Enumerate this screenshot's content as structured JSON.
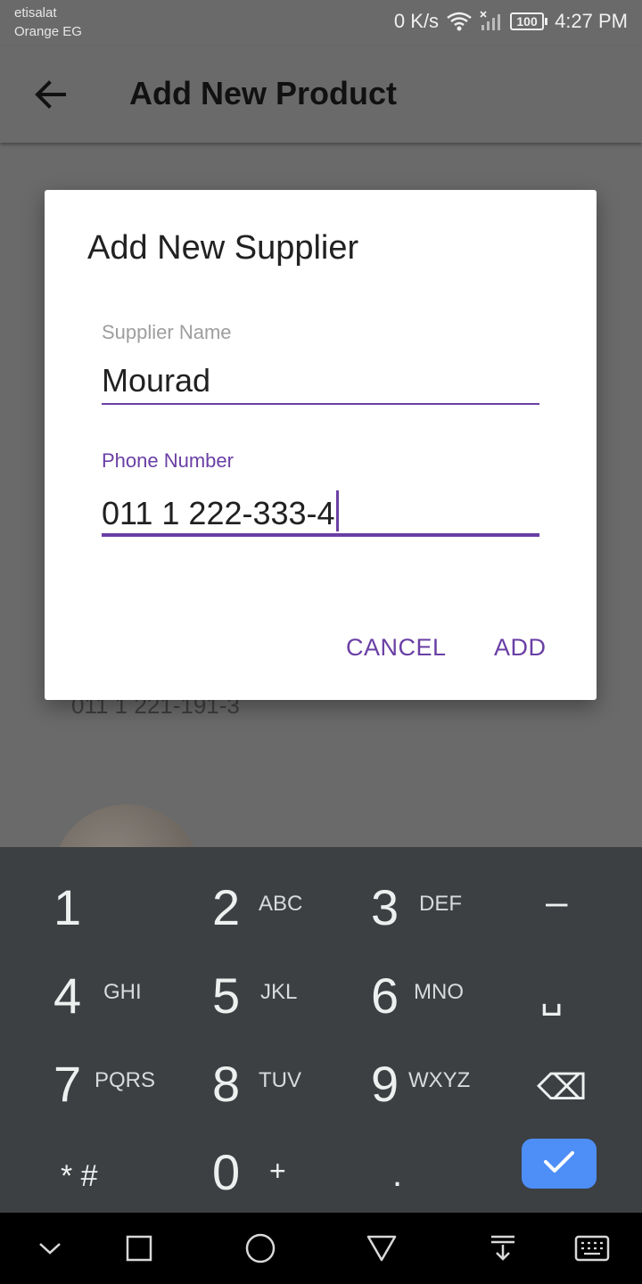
{
  "status_bar": {
    "carrier_line1": "etisalat",
    "carrier_line2": "Orange EG",
    "net_speed": "0 K/s",
    "battery": "100",
    "time": "4:27 PM"
  },
  "app_bar": {
    "title": "Add New Product",
    "back_icon": "arrow-back-icon"
  },
  "background": {
    "phone": "011 1 221-191-3"
  },
  "dialog": {
    "title": "Add New Supplier",
    "supplier_name_label": "Supplier Name",
    "supplier_name_value": "Mourad",
    "phone_label": "Phone Number",
    "phone_value": "011 1 222-333-4",
    "cancel_label": "CANCEL",
    "add_label": "ADD",
    "accent_color": "#6a3fa5"
  },
  "keyboard": {
    "keys": [
      {
        "num": "1",
        "letters": ""
      },
      {
        "num": "2",
        "letters": "ABC"
      },
      {
        "num": "3",
        "letters": "DEF"
      },
      {
        "num": "–",
        "letters": ""
      },
      {
        "num": "4",
        "letters": "GHI"
      },
      {
        "num": "5",
        "letters": "JKL"
      },
      {
        "num": "6",
        "letters": "MNO"
      },
      {
        "num": "␣",
        "letters": ""
      },
      {
        "num": "7",
        "letters": "PQRS"
      },
      {
        "num": "8",
        "letters": "TUV"
      },
      {
        "num": "9",
        "letters": "WXYZ"
      },
      {
        "num": "⌫",
        "letters": ""
      },
      {
        "num": "* #",
        "letters": ""
      },
      {
        "num": "0",
        "letters": "+"
      },
      {
        "num": ".",
        "letters": ""
      }
    ],
    "enter_icon": "check-icon",
    "enter_color": "#4e8ef7"
  },
  "nav_bar": {
    "icons": [
      "hide-keyboard-icon",
      "recents-icon",
      "home-icon",
      "back-icon",
      "notification-pull-icon",
      "keyboard-switch-icon"
    ]
  }
}
